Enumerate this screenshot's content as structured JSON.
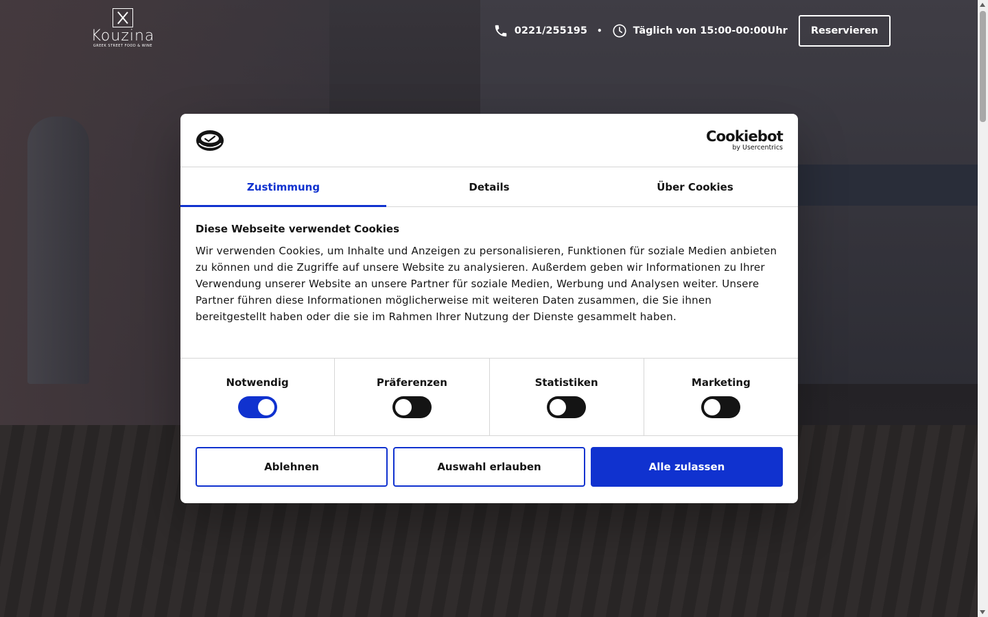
{
  "site": {
    "logo": {
      "name": "Kouzina",
      "tagline": "GREEK STREET FOOD & WINE"
    },
    "phone": "0221/255195",
    "separator": "•",
    "hours": "Täglich von 15:00-00:00Uhr",
    "reserve_label": "Reservieren"
  },
  "cookie_dialog": {
    "brand": {
      "name": "Cookiebot",
      "sub": "by Usercentrics"
    },
    "tabs": [
      {
        "label": "Zustimmung",
        "active": true
      },
      {
        "label": "Details",
        "active": false
      },
      {
        "label": "Über Cookies",
        "active": false
      }
    ],
    "heading": "Diese Webseite verwendet Cookies",
    "text": "Wir verwenden Cookies, um Inhalte und Anzeigen zu personalisieren, Funktionen für soziale Medien anbieten zu können und die Zugriffe auf unsere Website zu analysieren. Außerdem geben wir Informationen zu Ihrer Verwendung unserer Website an unsere Partner für soziale Medien, Werbung und Analysen weiter. Unsere Partner führen diese Informationen möglicherweise mit weiteren Daten zusammen, die Sie ihnen bereitgestellt haben oder die sie im Rahmen Ihrer Nutzung der Dienste gesammelt haben.",
    "categories": [
      {
        "label": "Notwendig",
        "enabled": true
      },
      {
        "label": "Präferenzen",
        "enabled": false
      },
      {
        "label": "Statistiken",
        "enabled": false
      },
      {
        "label": "Marketing",
        "enabled": false
      }
    ],
    "buttons": {
      "decline": "Ablehnen",
      "allow_selection": "Auswahl erlauben",
      "allow_all": "Alle zulassen"
    },
    "colors": {
      "accent": "#1032cf",
      "text": "#141414"
    }
  },
  "icons": [
    "phone-icon",
    "clock-icon",
    "cookie-icon"
  ]
}
